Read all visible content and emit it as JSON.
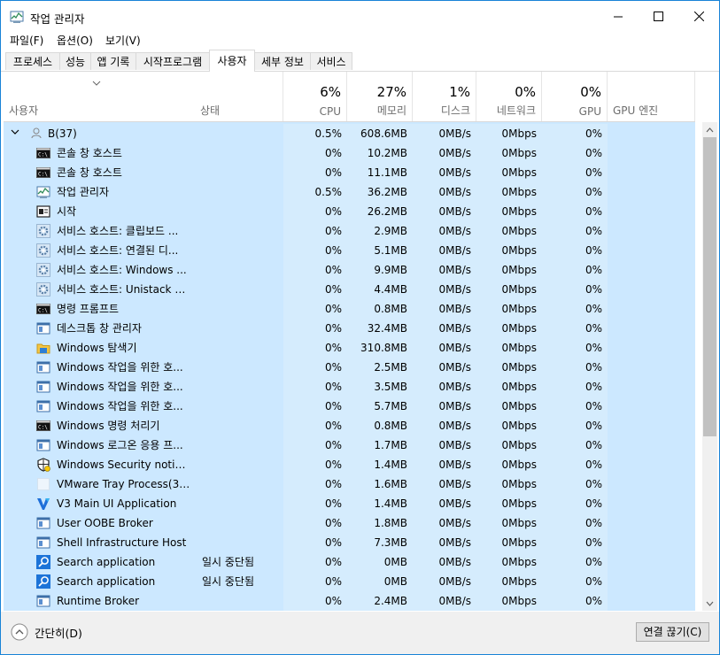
{
  "window": {
    "title": "작업 관리자"
  },
  "menu": [
    "파일(F)",
    "옵션(O)",
    "보기(V)"
  ],
  "tabs": [
    "프로세스",
    "성능",
    "앱 기록",
    "시작프로그램",
    "사용자",
    "세부 정보",
    "서비스"
  ],
  "active_tab": "사용자",
  "columns": {
    "user": "사용자",
    "status": "상태",
    "cpu": {
      "pct": "6%",
      "name": "CPU"
    },
    "memory": {
      "pct": "27%",
      "name": "메모리"
    },
    "disk": {
      "pct": "1%",
      "name": "디스크"
    },
    "network": {
      "pct": "0%",
      "name": "네트워크"
    },
    "gpu": {
      "pct": "0%",
      "name": "GPU"
    },
    "gpu_engine": "GPU 엔진"
  },
  "group": {
    "name": "B(37)",
    "cpu": "0.5%",
    "memory": "608.6MB",
    "disk": "0MB/s",
    "network": "0Mbps",
    "gpu": "0%"
  },
  "processes": [
    {
      "icon": "console-icon",
      "name": "콘솔 창 호스트",
      "status": "",
      "cpu": "0%",
      "memory": "10.2MB",
      "disk": "0MB/s",
      "network": "0Mbps",
      "gpu": "0%"
    },
    {
      "icon": "console-icon",
      "name": "콘솔 창 호스트",
      "status": "",
      "cpu": "0%",
      "memory": "11.1MB",
      "disk": "0MB/s",
      "network": "0Mbps",
      "gpu": "0%"
    },
    {
      "icon": "taskmgr-icon",
      "name": "작업 관리자",
      "status": "",
      "cpu": "0.5%",
      "memory": "36.2MB",
      "disk": "0MB/s",
      "network": "0Mbps",
      "gpu": "0%"
    },
    {
      "icon": "start-icon",
      "name": "시작",
      "status": "",
      "cpu": "0%",
      "memory": "26.2MB",
      "disk": "0MB/s",
      "network": "0Mbps",
      "gpu": "0%"
    },
    {
      "icon": "gear-icon",
      "name": "서비스 호스트: 클립보드 ...",
      "status": "",
      "cpu": "0%",
      "memory": "2.9MB",
      "disk": "0MB/s",
      "network": "0Mbps",
      "gpu": "0%"
    },
    {
      "icon": "gear-icon",
      "name": "서비스 호스트: 연결된 디...",
      "status": "",
      "cpu": "0%",
      "memory": "5.1MB",
      "disk": "0MB/s",
      "network": "0Mbps",
      "gpu": "0%"
    },
    {
      "icon": "gear-icon",
      "name": "서비스 호스트: Windows ...",
      "status": "",
      "cpu": "0%",
      "memory": "9.9MB",
      "disk": "0MB/s",
      "network": "0Mbps",
      "gpu": "0%"
    },
    {
      "icon": "gear-icon",
      "name": "서비스 호스트: Unistack S...",
      "status": "",
      "cpu": "0%",
      "memory": "4.4MB",
      "disk": "0MB/s",
      "network": "0Mbps",
      "gpu": "0%"
    },
    {
      "icon": "console-icon",
      "name": "명령 프롬프트",
      "status": "",
      "cpu": "0%",
      "memory": "0.8MB",
      "disk": "0MB/s",
      "network": "0Mbps",
      "gpu": "0%"
    },
    {
      "icon": "window-icon",
      "name": "데스크톱 창 관리자",
      "status": "",
      "cpu": "0%",
      "memory": "32.4MB",
      "disk": "0MB/s",
      "network": "0Mbps",
      "gpu": "0%"
    },
    {
      "icon": "folder-icon",
      "name": "Windows 탐색기",
      "status": "",
      "cpu": "0%",
      "memory": "310.8MB",
      "disk": "0MB/s",
      "network": "0Mbps",
      "gpu": "0%"
    },
    {
      "icon": "window-icon",
      "name": "Windows 작업을 위한 호...",
      "status": "",
      "cpu": "0%",
      "memory": "2.5MB",
      "disk": "0MB/s",
      "network": "0Mbps",
      "gpu": "0%"
    },
    {
      "icon": "window-icon",
      "name": "Windows 작업을 위한 호...",
      "status": "",
      "cpu": "0%",
      "memory": "3.5MB",
      "disk": "0MB/s",
      "network": "0Mbps",
      "gpu": "0%"
    },
    {
      "icon": "window-icon",
      "name": "Windows 작업을 위한 호...",
      "status": "",
      "cpu": "0%",
      "memory": "5.7MB",
      "disk": "0MB/s",
      "network": "0Mbps",
      "gpu": "0%"
    },
    {
      "icon": "console-icon",
      "name": "Windows 명령 처리기",
      "status": "",
      "cpu": "0%",
      "memory": "0.8MB",
      "disk": "0MB/s",
      "network": "0Mbps",
      "gpu": "0%"
    },
    {
      "icon": "window-icon",
      "name": "Windows 로그온 응용 프...",
      "status": "",
      "cpu": "0%",
      "memory": "1.7MB",
      "disk": "0MB/s",
      "network": "0Mbps",
      "gpu": "0%"
    },
    {
      "icon": "shield-icon",
      "name": "Windows Security notifica...",
      "status": "",
      "cpu": "0%",
      "memory": "1.4MB",
      "disk": "0MB/s",
      "network": "0Mbps",
      "gpu": "0%"
    },
    {
      "icon": "blank-icon",
      "name": "VMware Tray Process(32...",
      "status": "",
      "cpu": "0%",
      "memory": "1.6MB",
      "disk": "0MB/s",
      "network": "0Mbps",
      "gpu": "0%"
    },
    {
      "icon": "v3-icon",
      "name": "V3 Main UI Application",
      "status": "",
      "cpu": "0%",
      "memory": "1.4MB",
      "disk": "0MB/s",
      "network": "0Mbps",
      "gpu": "0%"
    },
    {
      "icon": "window-icon",
      "name": "User OOBE Broker",
      "status": "",
      "cpu": "0%",
      "memory": "1.8MB",
      "disk": "0MB/s",
      "network": "0Mbps",
      "gpu": "0%"
    },
    {
      "icon": "window-icon",
      "name": "Shell Infrastructure Host",
      "status": "",
      "cpu": "0%",
      "memory": "7.3MB",
      "disk": "0MB/s",
      "network": "0Mbps",
      "gpu": "0%"
    },
    {
      "icon": "search-icon",
      "name": "Search application",
      "status": "일시 중단됨",
      "cpu": "0%",
      "memory": "0MB",
      "disk": "0MB/s",
      "network": "0Mbps",
      "gpu": "0%"
    },
    {
      "icon": "search-icon",
      "name": "Search application",
      "status": "일시 중단됨",
      "cpu": "0%",
      "memory": "0MB",
      "disk": "0MB/s",
      "network": "0Mbps",
      "gpu": "0%"
    },
    {
      "icon": "window-icon",
      "name": "Runtime Broker",
      "status": "",
      "cpu": "0%",
      "memory": "2.4MB",
      "disk": "0MB/s",
      "network": "0Mbps",
      "gpu": "0%"
    }
  ],
  "footer": {
    "fewer_details": "간단히(D)",
    "disconnect": "연결 끊기(C)"
  }
}
